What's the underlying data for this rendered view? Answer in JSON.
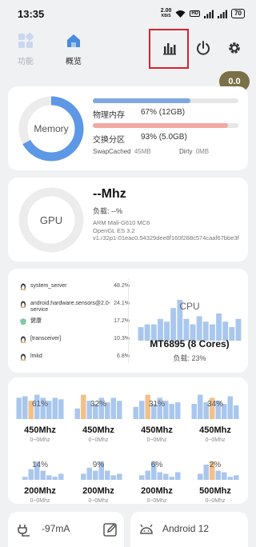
{
  "status_bar": {
    "time": "13:35",
    "net_speed_value": "2.00",
    "net_speed_unit": "KB/S",
    "hd_label": "HD",
    "battery": "70"
  },
  "nav": {
    "tab_functions": "功能",
    "tab_overview": "概览",
    "active_tab": "概览",
    "icons": [
      "stats-bars-icon",
      "power-icon",
      "gear-icon"
    ]
  },
  "badge": {
    "value": "0.0",
    "color": "#7a7148"
  },
  "memory": {
    "label": "Memory",
    "gauge_percent": 67,
    "physical_label": "物理内存",
    "physical_value": "67% (12GB)",
    "physical_percent": 67,
    "swap_label": "交换分区",
    "swap_value": "93% (5.0GB)",
    "swap_percent": 93,
    "swapcached_label": "SwapCached",
    "swapcached_value": "45MB",
    "dirty_label": "Dirty",
    "dirty_value": "0MB",
    "colors": {
      "physical": "#7fa8e0",
      "swap": "#f0aaa3"
    }
  },
  "gpu": {
    "label": "GPU",
    "freq": "--Mhz",
    "load": "负载:  --%",
    "model": "ARM Mali-G610 MC6",
    "opengl": "OpenGL ES 3.2",
    "driver": "v1.r32p1-01eac0.54329dee8f160f288c574caaf67bbe3f"
  },
  "cpu": {
    "word": "CPU",
    "model": "MT6895 (8 Cores)",
    "load": "负载:  23%",
    "processes": [
      {
        "name": "system_server",
        "value": "48.2%",
        "icon": "linux-penguin-icon"
      },
      {
        "name": "android.hardware.sensors@2.0-service",
        "value": "24.1%",
        "icon": "linux-penguin-icon"
      },
      {
        "name": "健康",
        "value": "17.2%",
        "icon": "app-shield-icon"
      },
      {
        "name": "[transceiver]",
        "value": "10.3%",
        "icon": "linux-penguin-icon"
      },
      {
        "name": "lmkd",
        "value": "6.8%",
        "icon": "linux-penguin-icon"
      }
    ],
    "history_load": [
      0.25,
      0.3,
      0.3,
      0.4,
      0.35,
      0.6,
      0.75,
      0.4,
      0.3,
      0.45,
      0.35,
      0.3,
      0.5,
      0.35,
      0.25,
      0.4
    ]
  },
  "cores": [
    {
      "load": "61%",
      "freq": "450Mhz",
      "range": "0~0Mhz",
      "history": [
        0.7,
        0.75,
        0.6,
        0.8,
        0.7,
        0.6,
        0.7,
        0.65
      ],
      "highlight": 2
    },
    {
      "load": "32%",
      "freq": "450Mhz",
      "range": "0~0Mhz",
      "history": [
        0.35,
        0.8,
        0.6,
        0.5,
        0.7,
        0.55,
        0.7,
        0.6
      ],
      "highlight": 1
    },
    {
      "load": "31%",
      "freq": "450Mhz",
      "range": "0~0Mhz",
      "history": [
        0.4,
        0.6,
        0.8,
        0.5,
        0.7,
        0.6,
        0.5,
        0.55
      ],
      "highlight": 2
    },
    {
      "load": "34%",
      "freq": "450Mhz",
      "range": "0~0Mhz",
      "history": [
        0.5,
        0.8,
        0.55,
        0.7,
        0.6,
        0.5,
        0.75,
        0.45
      ],
      "highlight": 3
    },
    {
      "load": "14%",
      "freq": "200Mhz",
      "range": "0~0Mhz",
      "history": [
        0.0,
        0.1,
        0.35,
        0.6,
        0.3,
        0.15,
        0.1,
        0.2
      ],
      "highlight": -1
    },
    {
      "load": "9%",
      "freq": "200Mhz",
      "range": "0~0Mhz",
      "history": [
        0.0,
        0.2,
        0.4,
        0.3,
        0.6,
        0.3,
        0.15,
        0.2
      ],
      "highlight": -1
    },
    {
      "load": "6%",
      "freq": "200Mhz",
      "range": "0~0Mhz",
      "history": [
        0.0,
        0.15,
        0.3,
        0.6,
        0.25,
        0.2,
        0.1,
        0.25
      ],
      "highlight": -1
    },
    {
      "load": "2%",
      "freq": "500Mhz",
      "range": "0~0Mhz",
      "history": [
        0.0,
        0.2,
        0.5,
        0.6,
        0.3,
        0.25,
        0.1,
        0.15
      ],
      "highlight": 3
    }
  ],
  "bottom": {
    "current": "-97mA",
    "android": "Android 12"
  },
  "colors": {
    "bar_blue": "#a9c7ee",
    "bar_orange": "#f2c089",
    "gauge_blue": "#5c98e6",
    "gauge_track": "#ececec",
    "highlight_box": "#d3242e"
  }
}
